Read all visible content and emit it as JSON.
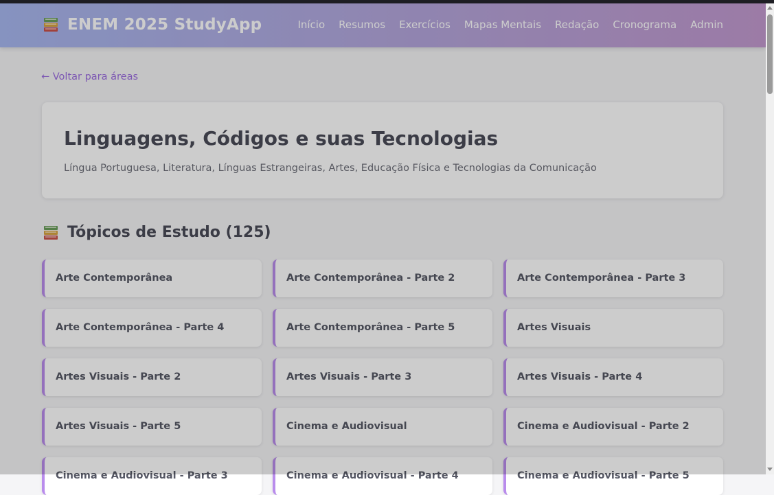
{
  "app": {
    "brand_icon": "books-icon",
    "title": "ENEM 2025 StudyApp"
  },
  "nav": [
    "Início",
    "Resumos",
    "Exercícios",
    "Mapas Mentais",
    "Redação",
    "Cronograma",
    "Admin"
  ],
  "back_link": "← Voltar para áreas",
  "area": {
    "title": "Linguagens, Códigos e suas Tecnologias",
    "subtitle": "Língua Portuguesa, Literatura, Línguas Estrangeiras, Artes, Educação Física e Tecnologias da Comunicação"
  },
  "topics_section": {
    "icon": "books-icon",
    "title": "Tópicos de Estudo (125)"
  },
  "topics": [
    "Arte Contemporânea",
    "Arte Contemporânea - Parte 2",
    "Arte Contemporânea - Parte 3",
    "Arte Contemporânea - Parte 4",
    "Arte Contemporânea - Parte 5",
    "Artes Visuais",
    "Artes Visuais - Parte 2",
    "Artes Visuais - Parte 3",
    "Artes Visuais - Parte 4",
    "Artes Visuais - Parte 5",
    "Cinema e Audiovisual",
    "Cinema e Audiovisual - Parte 2",
    "Cinema e Audiovisual - Parte 3",
    "Cinema e Audiovisual - Parte 4",
    "Cinema e Audiovisual - Parte 5"
  ],
  "colors": {
    "accent": "#b98cec",
    "link": "#9d6fe0",
    "header_gradient_start": "#a8b8f0",
    "header_gradient_end": "#c39ad0"
  }
}
